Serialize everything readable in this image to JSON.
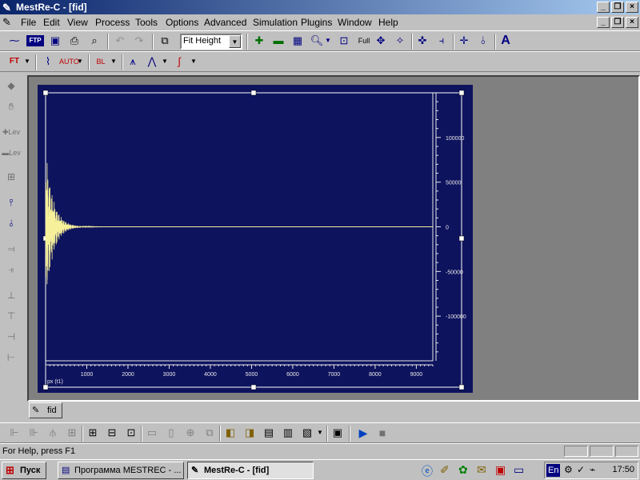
{
  "window": {
    "title": "MestRe-C - [fid]"
  },
  "menu": [
    "File",
    "Edit",
    "View",
    "Process",
    "Tools",
    "Options",
    "Advanced",
    "Simulation",
    "Plugins",
    "Window",
    "Help"
  ],
  "toolbar": {
    "zoom_select": "Fit Height",
    "full_label": "Full",
    "ftp_label": "FTP"
  },
  "tab": {
    "label": "fid"
  },
  "status": {
    "text": "For Help, press F1"
  },
  "taskbar": {
    "start_label": "Пуск",
    "tasks": [
      "Программа MESTREC - ...",
      "MestRe-C - [fid]"
    ],
    "lang": "En",
    "clock": "17:50"
  },
  "chart_data": {
    "type": "line",
    "xlabel": "px (t1)",
    "x_ticks": [
      1000,
      2000,
      3000,
      4000,
      5000,
      6000,
      7000,
      8000,
      9000
    ],
    "y_ticks": [
      100000,
      50000,
      0,
      -50000,
      -100000
    ],
    "xlim": [
      0,
      9400
    ],
    "ylim": [
      -150000,
      150000
    ],
    "series_color": "#f6f09a",
    "decay": {
      "amplitude": 90000,
      "tau": 180
    }
  }
}
